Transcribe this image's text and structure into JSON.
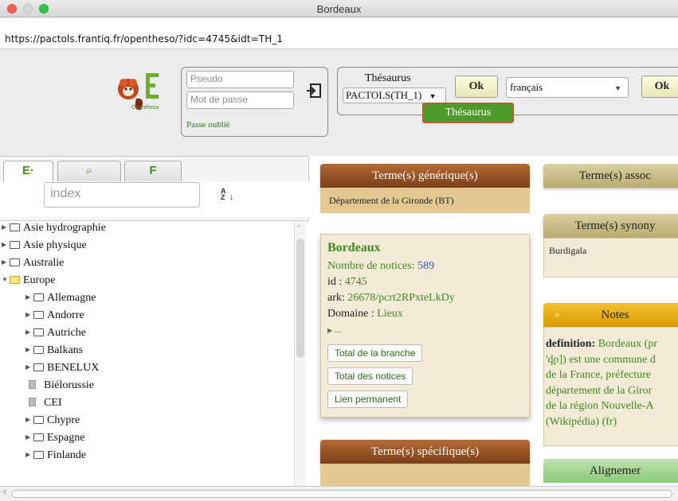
{
  "window": {
    "title": "Bordeaux"
  },
  "url": "https://pactols.frantiq.fr/opentheso/?idc=4745&idt=TH_1",
  "header": {
    "logo_text": "Opentheso",
    "login": {
      "pseudo_placeholder": "Pseudo",
      "password_placeholder": "Mot de passe",
      "forgot": "Passe oublié"
    },
    "thesaurus": {
      "label": "Thésaurus",
      "selected": "PACTOLS(TH_1)",
      "ok": "Ok",
      "language": "français",
      "ok2": "Ok",
      "tag": "Thésaurus"
    }
  },
  "left": {
    "tabs": [
      "E·",
      "P",
      "F"
    ],
    "index_placeholder": "index",
    "sort_label": "A Z",
    "tree": [
      {
        "label": "Asie hydrographie",
        "level": 0,
        "kind": "folder",
        "expanded": false
      },
      {
        "label": "Asie physique",
        "level": 0,
        "kind": "folder",
        "expanded": false
      },
      {
        "label": "Australie",
        "level": 0,
        "kind": "folder",
        "expanded": false
      },
      {
        "label": "Europe",
        "level": 0,
        "kind": "folder",
        "expanded": true
      },
      {
        "label": "Allemagne",
        "level": 1,
        "kind": "folder",
        "expanded": false
      },
      {
        "label": "Andorre",
        "level": 1,
        "kind": "folder",
        "expanded": false
      },
      {
        "label": "Autriche",
        "level": 1,
        "kind": "folder",
        "expanded": false
      },
      {
        "label": "Balkans",
        "level": 1,
        "kind": "folder",
        "expanded": false
      },
      {
        "label": "BENELUX",
        "level": 1,
        "kind": "folder",
        "expanded": false
      },
      {
        "label": "Biélorussie",
        "level": 1,
        "kind": "leaf",
        "expanded": false
      },
      {
        "label": "CEI",
        "level": 1,
        "kind": "leaf",
        "expanded": false
      },
      {
        "label": "Chypre",
        "level": 1,
        "kind": "folder",
        "expanded": false
      },
      {
        "label": "Espagne",
        "level": 1,
        "kind": "folder",
        "expanded": false
      },
      {
        "label": "Finlande",
        "level": 1,
        "kind": "folder",
        "expanded": false
      }
    ]
  },
  "right": {
    "generic_header": "Terme(s) générique(s)",
    "generic_value": "Département de la Gironde (BT)",
    "associated_header": "Terme(s) assoc",
    "synonym_header": "Terme(s) synony",
    "synonym_value": "Burdigala",
    "notes_header": "Notes",
    "notes_plus": "+",
    "notes_label": "definition:",
    "notes_lines": [
      "Bordeaux (pr",
      "'d̪o]) est une commune d",
      "de la France, préfecture",
      "département de la Giror",
      "de la région Nouvelle-A",
      "(Wikipédia) (fr)"
    ],
    "specific_header": "Terme(s) spécifique(s)",
    "alignment_header": "Alignemer",
    "term": {
      "name": "Bordeaux",
      "notices_label": "Nombre de notices:",
      "notices_value": "589",
      "id_label": "id :",
      "id_value": "4745",
      "ark_label": "ark:",
      "ark_value": "26678/pcrt2RPxteLkDy",
      "domain_label": "Domaine :",
      "domain_value": "Lieux",
      "more": "...",
      "buttons": [
        "Total de la branche",
        "Total des notices",
        "Lien permanent"
      ]
    }
  },
  "colors": {
    "accent_green": "#3b8a1c",
    "brown": "#8b4a1e",
    "tan": "#e4c894",
    "notes_yellow": "#f3c130"
  }
}
